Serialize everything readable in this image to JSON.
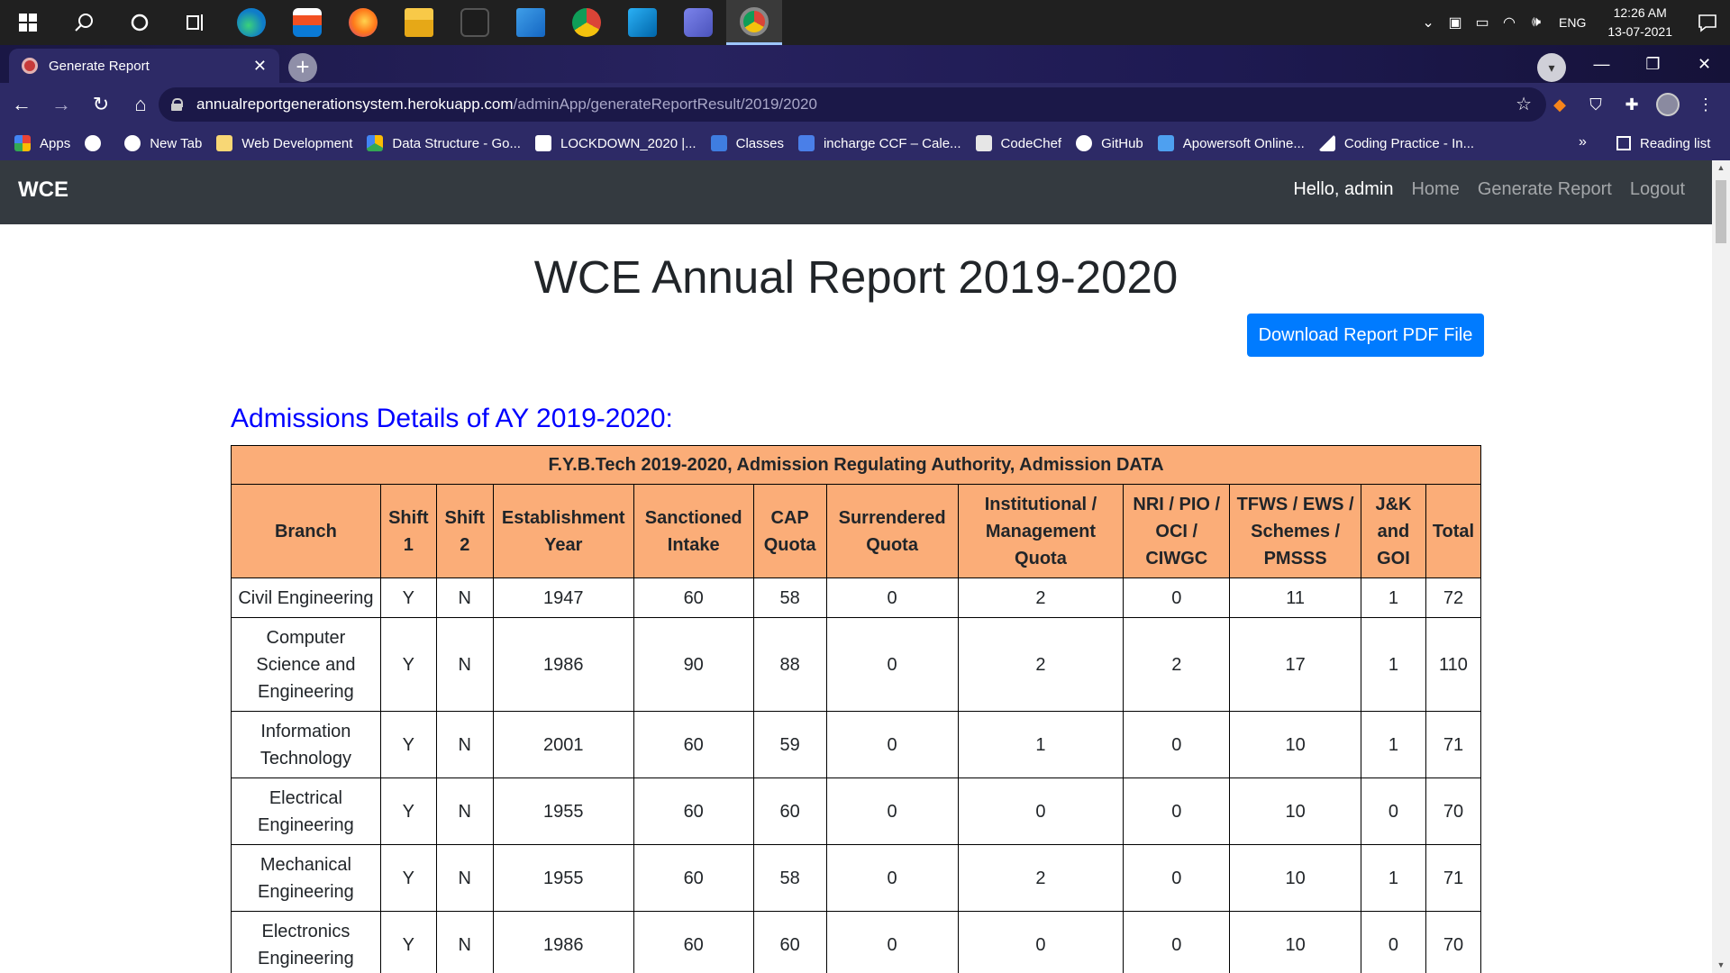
{
  "taskbar": {
    "tray": {
      "lang": "ENG",
      "time": "12:26 AM",
      "date": "13-07-2021"
    }
  },
  "browser": {
    "tab_title": "Generate Report",
    "url_host": "annualreportgenerationsystem.herokuapp.com",
    "url_path": "/adminApp/generateReportResult/2019/2020",
    "bookmarks": [
      "Apps",
      "New Tab",
      "Web Development",
      "Data Structure - Go...",
      "LOCKDOWN_2020 |...",
      "Classes",
      "incharge CCF – Cale...",
      "CodeChef",
      "GitHub",
      "Apowersoft Online...",
      "Coding Practice - In..."
    ],
    "bookmarks_more": "»",
    "reading_list": "Reading list"
  },
  "navbar": {
    "brand": "WCE",
    "greeting": "Hello, admin",
    "links": [
      "Home",
      "Generate Report",
      "Logout"
    ]
  },
  "page": {
    "title": "WCE Annual Report 2019-2020",
    "download_button": "Download Report PDF File",
    "section_title": "Admissions Details of AY 2019-2020:"
  },
  "table": {
    "caption": "F.Y.B.Tech 2019-2020, Admission Regulating Authority, Admission DATA",
    "headers": [
      "Branch",
      "Shift 1",
      "Shift 2",
      "Establishment Year",
      "Sanctioned Intake",
      "CAP Quota",
      "Surrendered Quota",
      "Institutional / Management Quota",
      "NRI / PIO / OCI / CIWGC",
      "TFWS / EWS / Schemes / PMSSS",
      "J&K and GOI",
      "Total"
    ],
    "rows": [
      [
        "Civil Engineering",
        "Y",
        "N",
        "1947",
        "60",
        "58",
        "0",
        "2",
        "0",
        "11",
        "1",
        "72"
      ],
      [
        "Computer Science and Engineering",
        "Y",
        "N",
        "1986",
        "90",
        "88",
        "0",
        "2",
        "2",
        "17",
        "1",
        "110"
      ],
      [
        "Information Technology",
        "Y",
        "N",
        "2001",
        "60",
        "59",
        "0",
        "1",
        "0",
        "10",
        "1",
        "71"
      ],
      [
        "Electrical Engineering",
        "Y",
        "N",
        "1955",
        "60",
        "60",
        "0",
        "0",
        "0",
        "10",
        "0",
        "70"
      ],
      [
        "Mechanical Engineering",
        "Y",
        "N",
        "1955",
        "60",
        "58",
        "0",
        "2",
        "0",
        "10",
        "1",
        "71"
      ],
      [
        "Electronics Engineering",
        "Y",
        "N",
        "1986",
        "60",
        "60",
        "0",
        "0",
        "0",
        "10",
        "0",
        "70"
      ]
    ]
  }
}
